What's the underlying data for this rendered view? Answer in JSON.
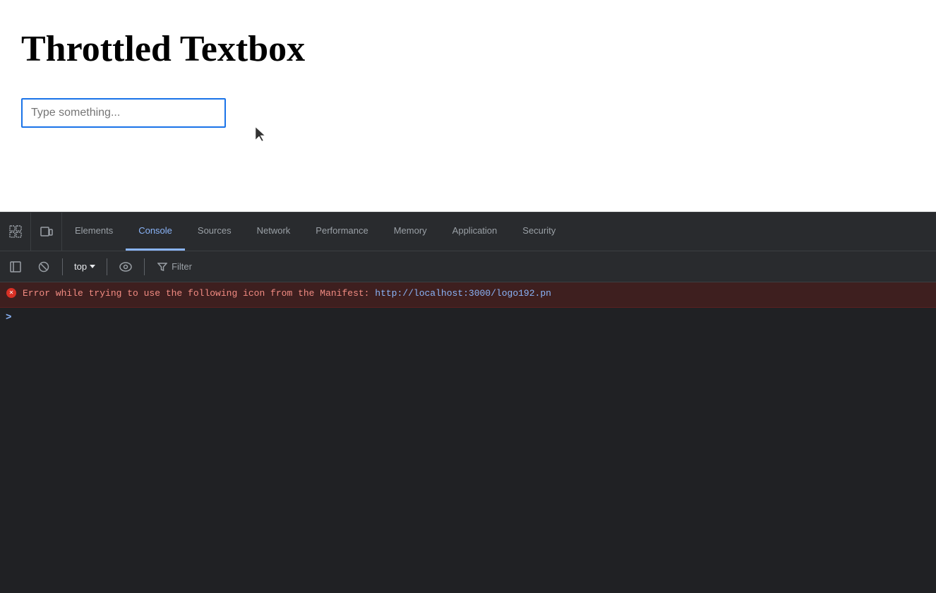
{
  "page": {
    "title": "Throttled Textbox",
    "input_placeholder": "Type something..."
  },
  "devtools": {
    "tabs": [
      {
        "id": "elements",
        "label": "Elements",
        "active": false
      },
      {
        "id": "console",
        "label": "Console",
        "active": true
      },
      {
        "id": "sources",
        "label": "Sources",
        "active": false
      },
      {
        "id": "network",
        "label": "Network",
        "active": false
      },
      {
        "id": "performance",
        "label": "Performance",
        "active": false
      },
      {
        "id": "memory",
        "label": "Memory",
        "active": false
      },
      {
        "id": "application",
        "label": "Application",
        "active": false
      },
      {
        "id": "security",
        "label": "Security",
        "active": false
      }
    ],
    "console_toolbar": {
      "top_label": "top",
      "filter_label": "Filter"
    },
    "console_error": {
      "message": "Error while trying to use the following icon from the Manifest: ",
      "link_text": "http://localhost:3000/logo192.pn",
      "link_href": "http://localhost:3000/logo192.png"
    },
    "console_prompt": ">"
  }
}
